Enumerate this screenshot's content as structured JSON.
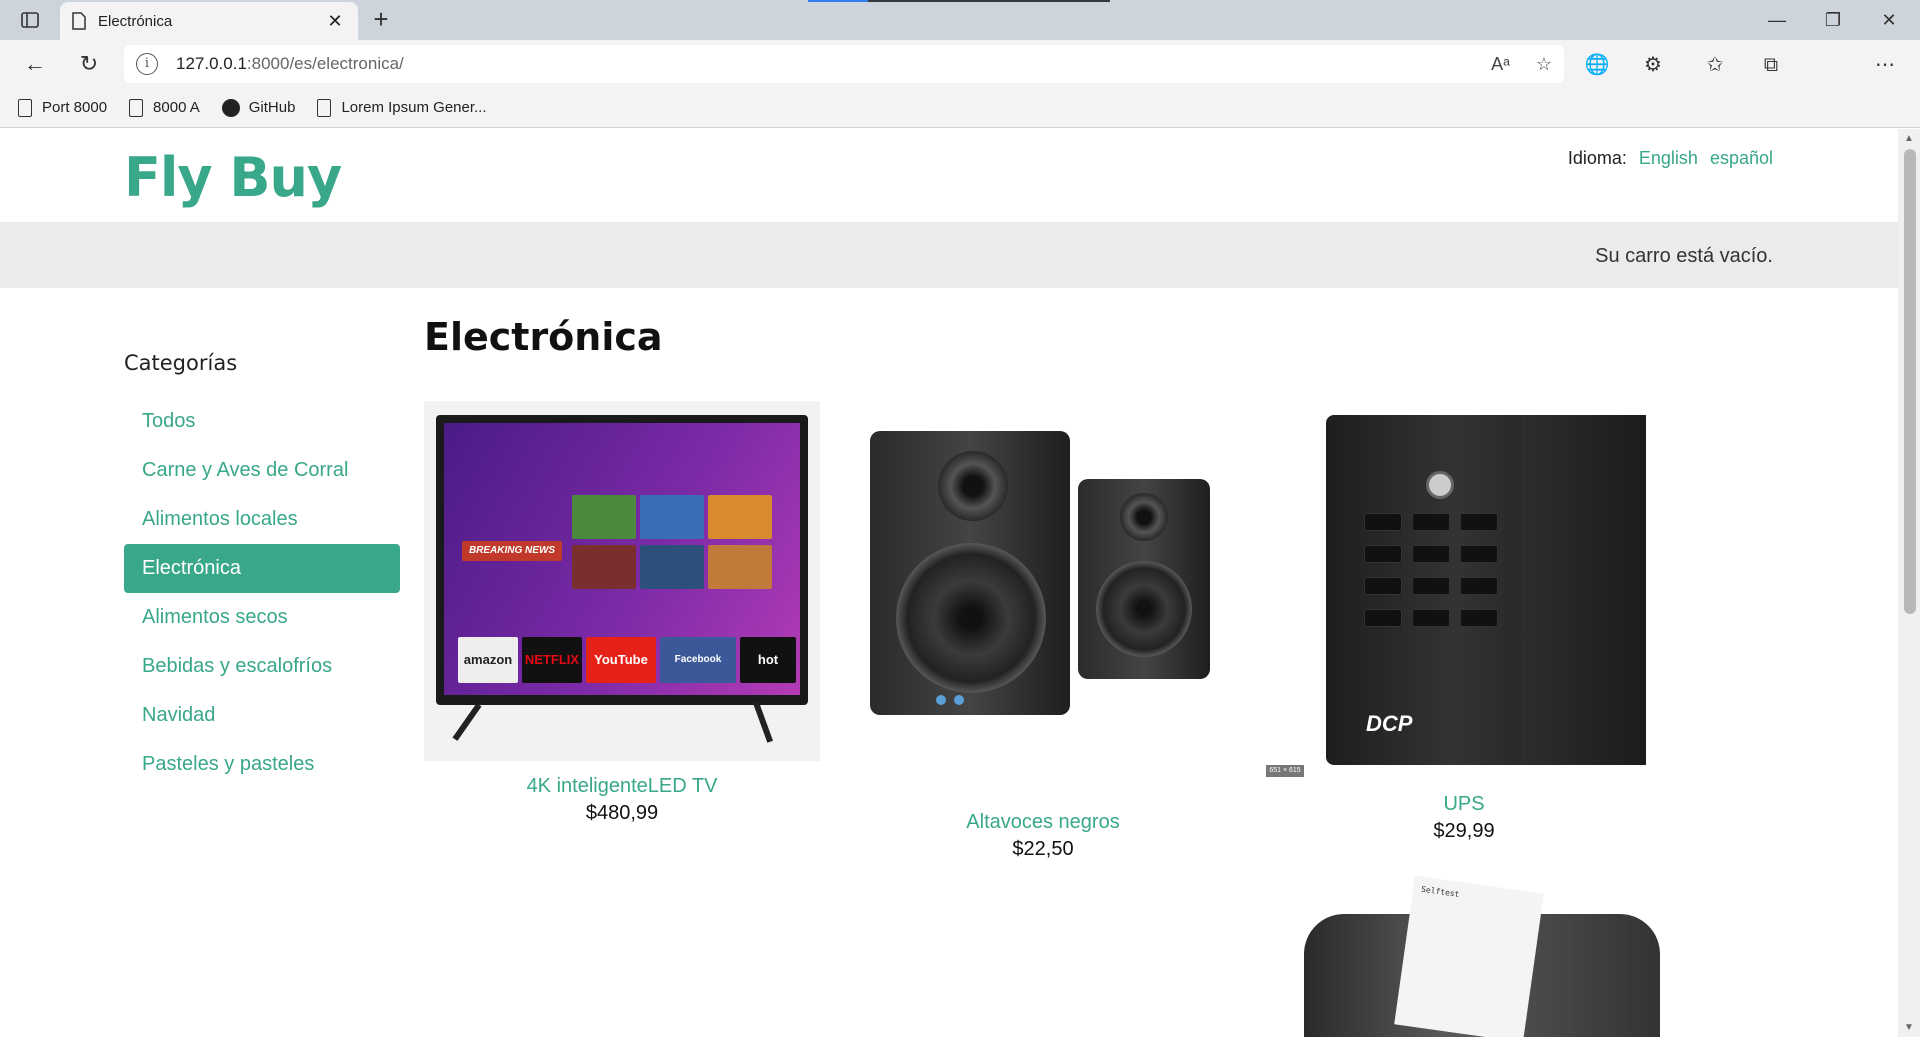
{
  "browser": {
    "tab_title": "Electrónica",
    "url_host": "127.0.0.1",
    "url_rest": ":8000/es/electronica/",
    "bookmarks": [
      "Port 8000",
      "8000 A",
      "GitHub",
      "Lorem Ipsum Gener..."
    ]
  },
  "site": {
    "logo": "Fly Buy",
    "language_label": "Idioma:",
    "languages": [
      "English",
      "español"
    ],
    "cart_status": "Su carro está vacío."
  },
  "sidebar": {
    "title": "Categorías",
    "items": [
      {
        "label": "Todos"
      },
      {
        "label": "Carne y Aves de Corral"
      },
      {
        "label": "Alimentos locales"
      },
      {
        "label": "Electrónica",
        "active": true
      },
      {
        "label": "Alimentos secos"
      },
      {
        "label": "Bebidas y escalofríos"
      },
      {
        "label": "Navidad"
      },
      {
        "label": "Pasteles y pasteles"
      }
    ]
  },
  "main": {
    "title": "Electrónica",
    "products": [
      {
        "name": "4K inteligenteLED TV",
        "price": "$480,99"
      },
      {
        "name": "Altavoces negros",
        "price": "$22,50"
      },
      {
        "name": "UPS",
        "price": "$29,99"
      }
    ]
  },
  "images": {
    "tv_apps": [
      "amazon prime",
      "NETFLIX",
      "YouTube",
      "Facebook",
      "hot"
    ],
    "tv_banner": "BREAKING NEWS",
    "ups_brand": "DCP",
    "ups_size_tag": "651 × 615",
    "printer_receipt": "Selftest"
  },
  "colors": {
    "brand": "#38a78a",
    "cart_bar": "#ebebeb"
  }
}
